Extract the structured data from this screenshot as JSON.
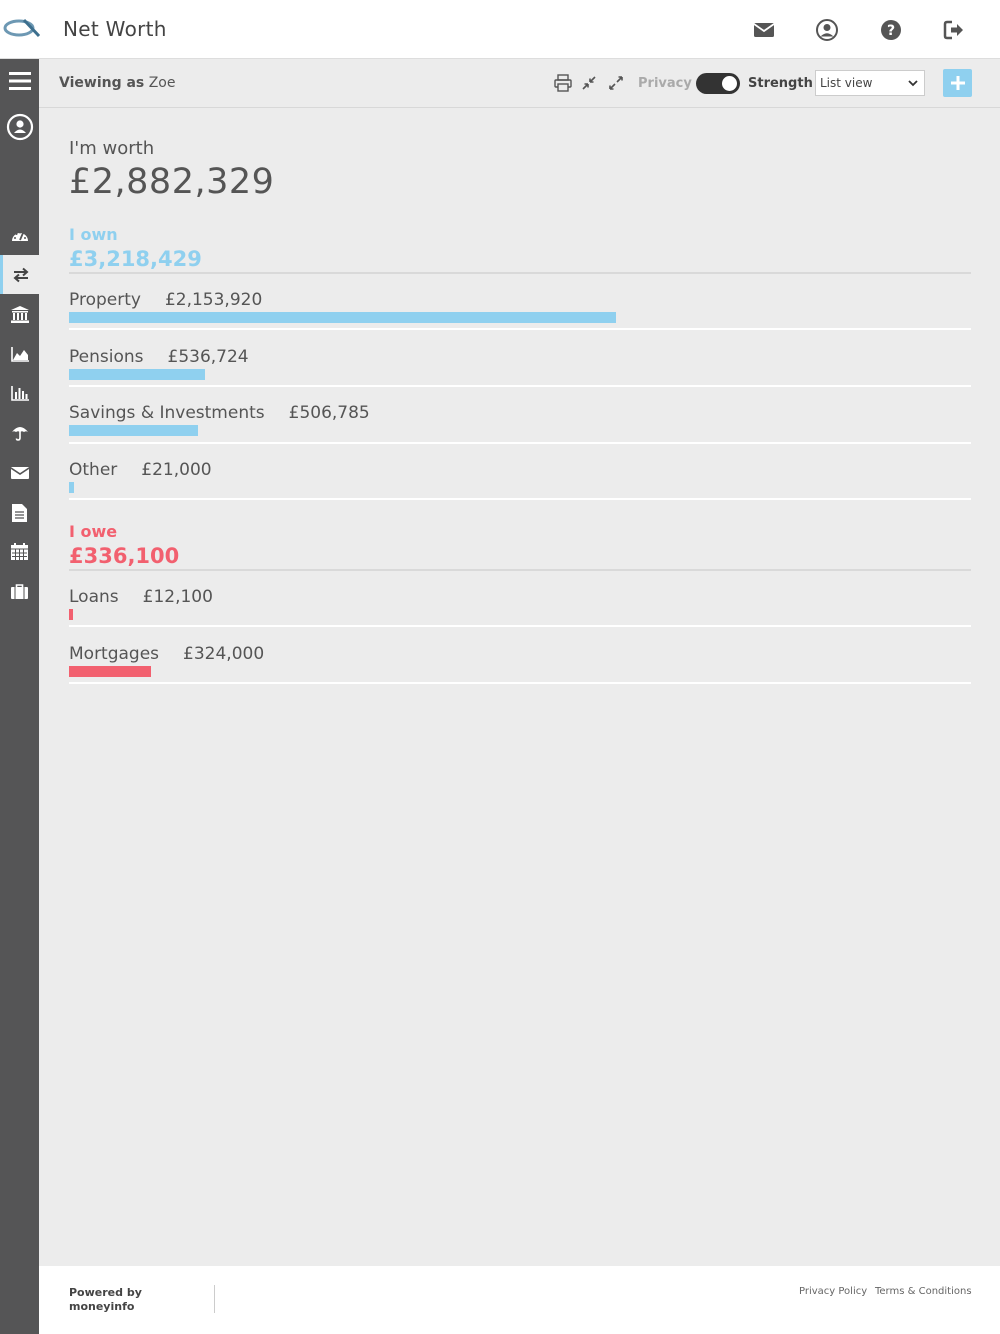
{
  "app": {
    "title": "Net Worth"
  },
  "toolbar": {
    "viewing_prefix": "Viewing as",
    "viewing_user": "Zoe",
    "privacy_label": "Privacy",
    "privacy_on": true,
    "strength_label": "Strength",
    "view_select": "List view"
  },
  "summary": {
    "worth_label": "I'm worth",
    "worth_value": "£2,882,329"
  },
  "own": {
    "label": "I own",
    "total": "£3,218,429",
    "items": [
      {
        "label": "Property",
        "amount": "£2,153,920",
        "value": 2153920
      },
      {
        "label": "Pensions",
        "amount": "£536,724",
        "value": 536724
      },
      {
        "label": "Savings & Investments",
        "amount": "£506,785",
        "value": 506785
      },
      {
        "label": "Other",
        "amount": "£21,000",
        "value": 21000
      }
    ]
  },
  "owe": {
    "label": "I owe",
    "total": "£336,100",
    "items": [
      {
        "label": "Loans",
        "amount": "£12,100",
        "value": 12100
      },
      {
        "label": "Mortgages",
        "amount": "£324,000",
        "value": 324000
      }
    ]
  },
  "footer": {
    "powered_line1": "Powered by",
    "powered_line2": "moneyinfo",
    "privacy_policy": "Privacy Policy",
    "terms": "Terms & Conditions"
  },
  "colors": {
    "own": "#8fd0ef",
    "owe": "#f2606f",
    "sidebar": "#555556"
  },
  "icons": {
    "topbar": [
      "envelope-icon",
      "user-circle-icon",
      "help-icon",
      "sign-out-icon"
    ],
    "sidebar": [
      "menu-icon",
      "profile-icon",
      "dashboard-icon",
      "transfer-icon",
      "bank-icon",
      "area-chart-icon",
      "bar-chart-icon",
      "umbrella-icon",
      "envelope-icon",
      "document-icon",
      "calendar-icon",
      "briefcase-icon"
    ]
  }
}
